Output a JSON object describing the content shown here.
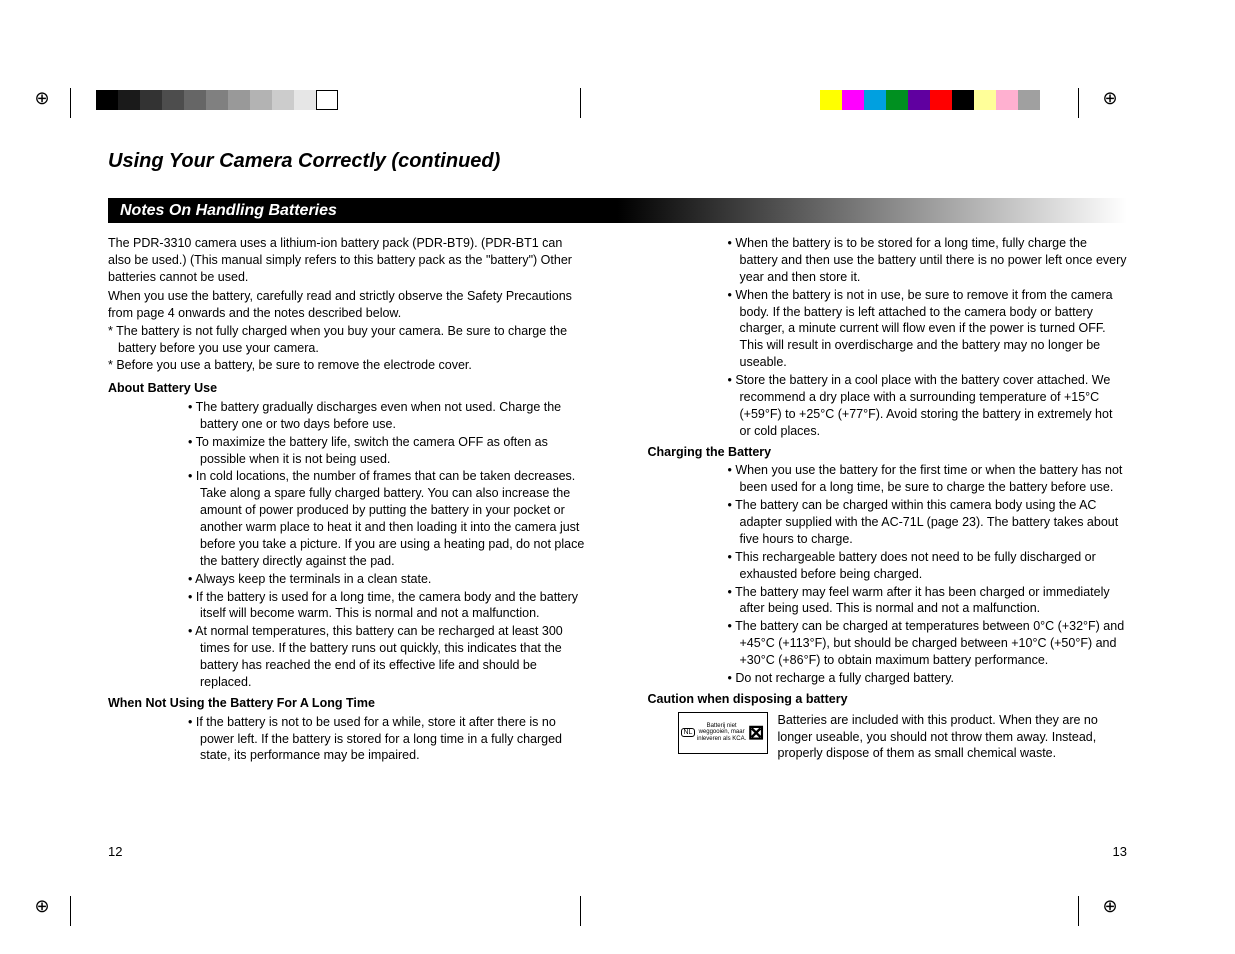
{
  "pageTitle": "Using Your Camera Correctly (continued)",
  "sectionTitle": "Notes On Handling Batteries",
  "introLines": [
    "The PDR-3310 camera uses a lithium-ion battery pack (PDR-BT9). (PDR-BT1 can also be used.) (This manual simply refers to this battery pack as the \"battery\") Other batteries cannot be used.",
    "When you use the battery, carefully read and strictly observe the Safety Precautions from page 4 onwards and the notes described below."
  ],
  "starNotes": [
    "The battery is not fully charged when you buy your camera. Be sure to charge the battery before you use your camera.",
    "Before you use a battery, be sure to remove the electrode cover."
  ],
  "aboutHeading": "About Battery Use",
  "aboutBullets": [
    "The battery gradually discharges even when not used. Charge the battery one or two days before use.",
    "To maximize the battery life, switch the camera OFF as often as possible when it is not being used.",
    "In cold locations, the number of frames that can be taken decreases. Take along a spare fully charged battery. You can also increase the amount of power produced by putting the battery in your pocket or another warm place to heat it and then loading it into the camera just before you take a picture. If you are using a heating pad, do not place the battery directly against the pad.",
    "Always keep the terminals in a clean state.",
    "If the battery is used for a long time, the camera body and the battery itself will become warm. This is normal and not a malfunction.",
    "At normal temperatures, this battery can be recharged at least 300 times for use. If the battery runs out quickly, this indicates that the battery has reached the end of its effective life and should be replaced."
  ],
  "longTimeHeading": "When Not Using the Battery For A Long Time",
  "longTimeBullets": [
    "If the battery is not to be used for a while, store it after there is no power left. If the battery is stored for a long time in a fully charged state, its performance may be impaired."
  ],
  "longTimeBullets2": [
    "When the battery is to be stored for a long time, fully charge the battery and then use the battery until there is no power left once every year and then store it.",
    "When the battery is not in use, be sure to remove it from the camera body. If the battery is left attached to the camera body or battery charger, a minute current will flow even if the power is turned OFF. This will result in overdischarge and the battery may no longer be useable.",
    "Store the battery in a cool place with the battery cover attached. We recommend a dry place with a surrounding temperature of +15°C (+59°F) to +25°C (+77°F). Avoid storing the battery in extremely hot or cold places."
  ],
  "chargingHeading": "Charging the Battery",
  "chargingBullets": [
    "When you use the battery for the first time or when the battery has not been used for a long time, be sure to charge the battery before use.",
    "The battery can be charged within this camera body using the AC adapter supplied with the AC-71L (page 23). The battery takes about five hours to charge.",
    "This rechargeable battery does not need to be fully discharged or exhausted before being charged.",
    "The battery may feel warm after it has been charged or immediately after being used. This is normal and not a malfunction.",
    "The battery can be charged at temperatures between 0°C (+32°F) and +45°C (+113°F), but should be charged between +10°C (+50°F) and +30°C (+86°F) to obtain maximum battery performance.",
    "Do not recharge a fully charged battery."
  ],
  "cautionHeading": "Caution when disposing a battery",
  "disposalIcon": {
    "nl": "NL",
    "text": "Batterij niet weggooien, maar inleveren als KCA."
  },
  "disposalText": "Batteries are included with this product. When they are no longer useable, you should not throw them away. Instead, properly dispose of them as small chemical waste.",
  "pageLeft": "12",
  "pageRight": "13",
  "swatchesGray": [
    "#000",
    "#1a1a1a",
    "#333",
    "#4d4d4d",
    "#666",
    "#808080",
    "#999",
    "#b3b3b3",
    "#ccc",
    "#e6e6e6",
    "#fff"
  ],
  "swatchesColor": [
    "#ffff00",
    "#ff00ff",
    "#00a0e0",
    "#009020",
    "#6000a0",
    "#ff0000",
    "#000000",
    "#ffff99",
    "#ffb0d0",
    "#a0a0a0"
  ]
}
